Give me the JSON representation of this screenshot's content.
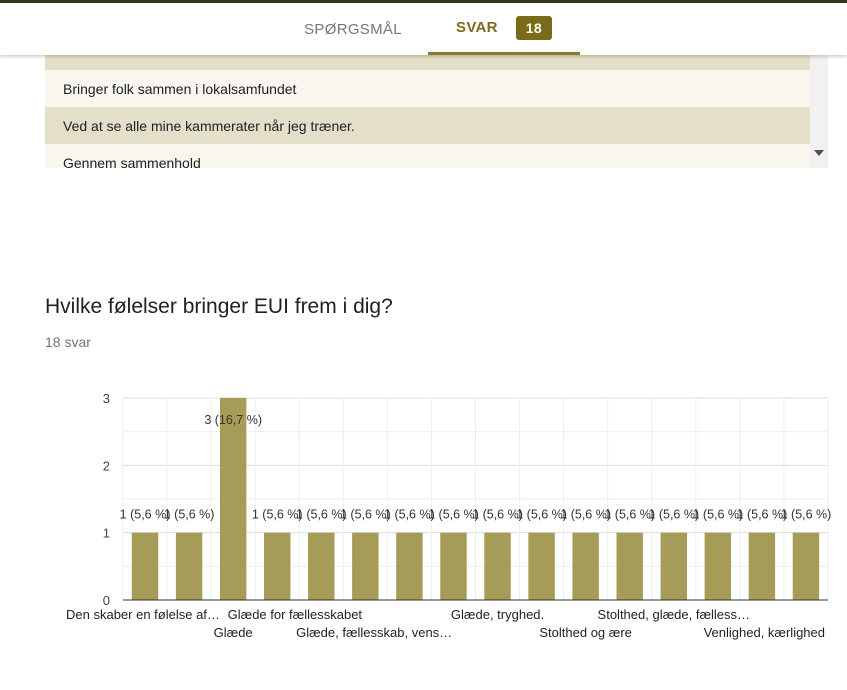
{
  "tabs": {
    "questions_label": "SPØRGSMÅL",
    "answers_label": "SVAR",
    "answers_count": "18"
  },
  "responses": {
    "rows": [
      "Bringer folk sammen i lokalsamfundet",
      "Ved at se alle mine kammerater når jeg træner.",
      "Gennem sammenhold"
    ]
  },
  "question": {
    "title": "Hvilke følelser bringer EUI frem i dig?",
    "response_count": "18 svar"
  },
  "colors": {
    "bar": "#a69b57",
    "accent": "#7a6b1a"
  },
  "chart_data": {
    "type": "bar",
    "ylim": [
      0,
      3
    ],
    "yticks": [
      "0",
      "1",
      "2",
      "3"
    ],
    "grid": true,
    "values": [
      1,
      1,
      3,
      1,
      1,
      1,
      1,
      1,
      1,
      1,
      1,
      1,
      1,
      1,
      1,
      1
    ],
    "bar_labels": [
      "1 (5,6 %)",
      "1 (5,6 %)",
      "3 (16,7 %)",
      "1 (5,6 %)",
      "1 (5,6 %)",
      "1 (5,6 %)",
      "1 (5,6 %)",
      "1 (5,6 %)",
      "1 (5,6 %)",
      "1 (5,6 %)",
      "1 (5,6 %)",
      "1 (5,6 %)",
      "1 (5,6 %)",
      "1 (5,6 %)",
      "1 (5,6 %)",
      "1 (5,6 %)"
    ],
    "x_labels_visible": [
      "Den skaber en følelse af…",
      "Glæde",
      "Glæde for fællesskabet",
      "Glæde, fællesskab, vens…",
      "Glæde, tryghed.",
      "Stolthed og ære",
      "Stolthed, glæde, fælless…",
      "Venlighed, kærlighed"
    ]
  }
}
